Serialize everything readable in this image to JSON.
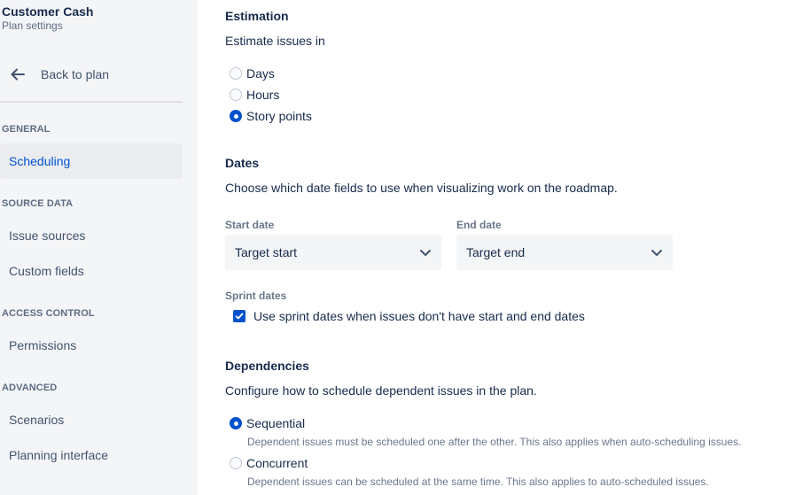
{
  "sidebar": {
    "plan_name": "Customer Cash",
    "plan_subtitle": "Plan settings",
    "back_label": "Back to plan",
    "groups": {
      "general": "GENERAL",
      "source_data": "SOURCE DATA",
      "access_control": "ACCESS CONTROL",
      "advanced": "ADVANCED"
    },
    "items": {
      "scheduling": "Scheduling",
      "issue_sources": "Issue sources",
      "custom_fields": "Custom fields",
      "permissions": "Permissions",
      "scenarios": "Scenarios",
      "planning_interface": "Planning interface"
    },
    "active_item": "Scheduling"
  },
  "estimation": {
    "title": "Estimation",
    "description": "Estimate issues in",
    "options": [
      "Days",
      "Hours",
      "Story points"
    ],
    "selected": "Story points"
  },
  "dates": {
    "title": "Dates",
    "description": "Choose which date fields to use when visualizing work on the roadmap.",
    "start_label": "Start date",
    "start_value": "Target start",
    "end_label": "End date",
    "end_value": "Target end",
    "sprint_label": "Sprint dates",
    "sprint_checkbox_label": "Use sprint dates when issues don't have start and end dates",
    "sprint_checked": true
  },
  "dependencies": {
    "title": "Dependencies",
    "description": "Configure how to schedule dependent issues in the plan.",
    "sequential_label": "Sequential",
    "sequential_help": "Dependent issues must be scheduled one after the other. This also applies when auto-scheduling issues.",
    "concurrent_label": "Concurrent",
    "concurrent_help": "Dependent issues can be scheduled at the same time. This also applies to auto-scheduled issues.",
    "selected": "Sequential"
  },
  "colors": {
    "accent": "#0052cc",
    "sidebar_bg": "#f4f5f7",
    "active_bg": "#ebecf0"
  },
  "icons": {
    "back": "arrow-left-icon",
    "select": "chevron-down-icon",
    "check": "check-icon"
  }
}
